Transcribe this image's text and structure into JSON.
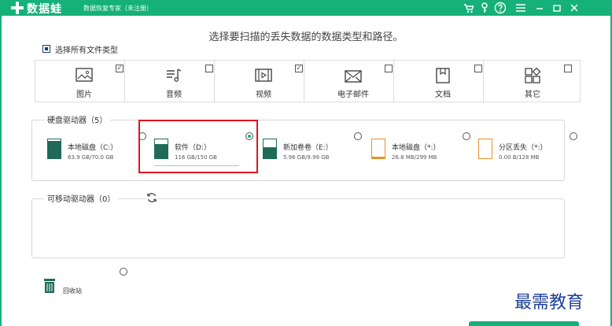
{
  "titlebar": {
    "brand": "数据蛙",
    "subtitle": "数据恢复专家（未注册）",
    "icons": [
      "cart-icon",
      "key-icon",
      "help-icon",
      "menu-icon",
      "minimize-icon",
      "maximize-icon",
      "close-icon"
    ],
    "accent": "#16b07a"
  },
  "headline": "选择要扫描的丢失数据的数据类型和路径。",
  "select_all": {
    "label": "选择所有文件类型",
    "checked": true
  },
  "file_types": [
    {
      "label": "图片",
      "icon": "image-icon",
      "checked": true
    },
    {
      "label": "音频",
      "icon": "audio-icon",
      "checked": false
    },
    {
      "label": "视频",
      "icon": "video-icon",
      "checked": true
    },
    {
      "label": "电子邮件",
      "icon": "email-icon",
      "checked": false
    },
    {
      "label": "文档",
      "icon": "document-icon",
      "checked": false
    },
    {
      "label": "其它",
      "icon": "other-icon",
      "checked": false
    }
  ],
  "hard_drives": {
    "label": "硬盘驱动器（5）",
    "items": [
      {
        "name": "本地磁盘（C:）",
        "size": "63.9 GB/70.0 GB",
        "used_fraction": 0.91,
        "selected": false,
        "fill_color": "#1f6b57"
      },
      {
        "name": "软件（D:）",
        "size": "116 GB/150 GB",
        "used_fraction": 0.77,
        "selected": true,
        "fill_color": "#1f6b57"
      },
      {
        "name": "新加卷卷（E:）",
        "size": "5.96 GB/9.99 GB",
        "used_fraction": 0.6,
        "selected": false,
        "fill_color": "#1f6b57"
      },
      {
        "name": "本地磁盘（*:）",
        "size": "26.8 MB/299 MB",
        "used_fraction": 0.09,
        "selected": false,
        "fill_color": "#e8912b"
      },
      {
        "name": "分区丢失（*:）",
        "size": "0.00  B/128 MB",
        "used_fraction": 0.0,
        "selected": false,
        "fill_color": "#e8912b"
      }
    ]
  },
  "removable": {
    "label": "可移动驱动器（0）",
    "refresh_icon": "refresh-icon"
  },
  "recycle": {
    "label": "回收站",
    "icon": "trash-icon",
    "selected": false
  },
  "watermark": "最需教育"
}
